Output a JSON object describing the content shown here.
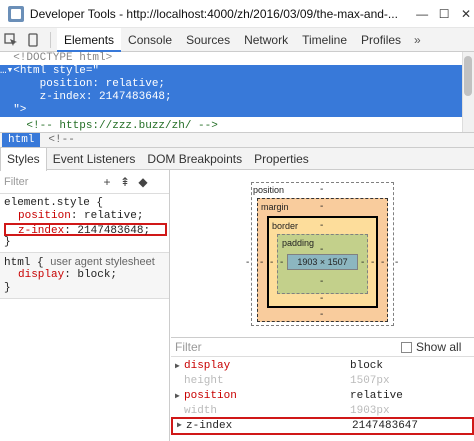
{
  "window": {
    "title": "Developer Tools - http://localhost:4000/zh/2016/03/09/the-max-and-...",
    "controls": [
      "—",
      "☐",
      "✕"
    ]
  },
  "toolbar": {
    "tabs": [
      "Elements",
      "Console",
      "Sources",
      "Network",
      "Timeline",
      "Profiles"
    ],
    "more": "»",
    "active_tab": "Elements"
  },
  "dom": {
    "lines": [
      "  <!DOCTYPE html>",
      "…▾<html style=\"",
      "      position: relative;",
      "      z-index: 2147483648;",
      "  \">",
      "    <!-- https://zzz.buzz/zh/ -->"
    ]
  },
  "breadcrumb": {
    "items": [
      "html",
      "<!--"
    ]
  },
  "styles_tabs": [
    "Styles",
    "Event Listeners",
    "DOM Breakpoints",
    "Properties"
  ],
  "styles": {
    "filter_placeholder": "Filter",
    "filter_icons": [
      "+",
      "⇞",
      "◆"
    ],
    "rule1": {
      "selector": "element.style {",
      "decls": [
        {
          "name": "position",
          "value": " relative;"
        },
        {
          "name": "z-index",
          "value": " 2147483648;"
        }
      ],
      "close": "}"
    },
    "rule2": {
      "selector": "html {",
      "source": "user agent stylesheet",
      "decls": [
        {
          "name": "display",
          "value": " block;"
        }
      ],
      "close": "}"
    }
  },
  "box_model": {
    "position_label": "position",
    "margin_label": "margin",
    "border_label": "border",
    "padding_label": "padding",
    "content": "1903 × 1507",
    "dash": "-"
  },
  "computed": {
    "filter_placeholder": "Filter",
    "show_all": "Show all",
    "rows": [
      {
        "name": "display",
        "value": "block",
        "inherited": false,
        "expandable": true
      },
      {
        "name": "height",
        "value": "1507px",
        "inherited": true,
        "expandable": false
      },
      {
        "name": "position",
        "value": "relative",
        "inherited": false,
        "expandable": true
      },
      {
        "name": "width",
        "value": "1903px",
        "inherited": true,
        "expandable": false
      },
      {
        "name": "z-index",
        "value": "2147483647",
        "inherited": false,
        "expandable": true
      }
    ]
  },
  "colors": {
    "selection": "#3879d9",
    "highlight_box": "#d01818",
    "margin": "#f9cc9d",
    "border": "#fddd9b",
    "padding": "#c3d08b",
    "content": "#8cb6c0"
  }
}
